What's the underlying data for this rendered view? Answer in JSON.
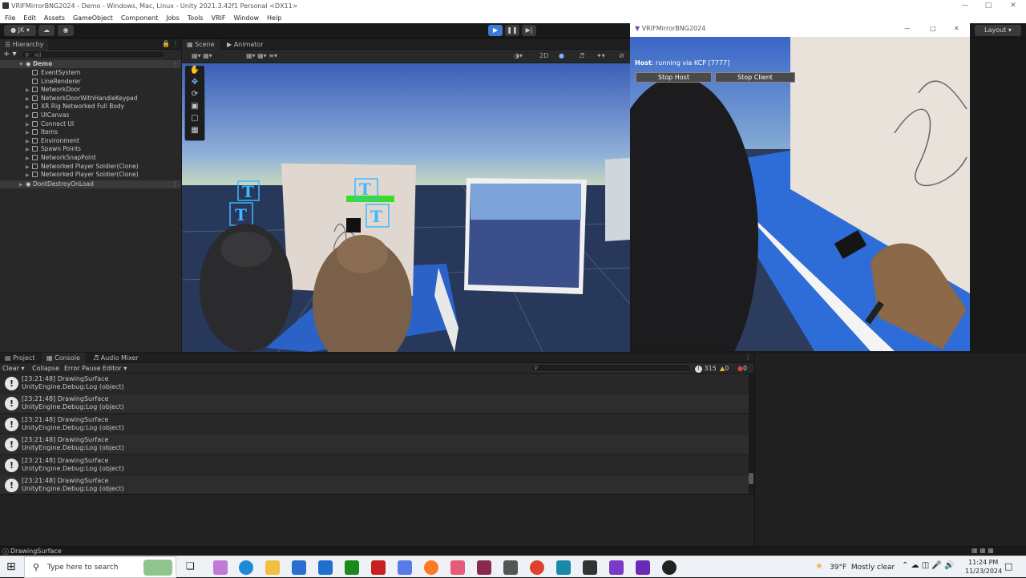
{
  "window": {
    "title": "VRIFMirrorBNG2024 - Demo - Windows, Mac, Linux - Unity 2021.3.42f1 Personal <DX11>"
  },
  "menu": [
    "File",
    "Edit",
    "Assets",
    "GameObject",
    "Component",
    "Jobs",
    "Tools",
    "VRIF",
    "Window",
    "Help"
  ],
  "toolbar": {
    "account": "JK",
    "layout": "Layout"
  },
  "hierarchy": {
    "tab": "Hierarchy",
    "search_placeholder": "All",
    "scene": "Demo",
    "items": [
      "EventSystem",
      "LineRenderer",
      "NetworkDoor",
      "NetworkDoorWithHandleKeypad",
      "XR Rig Networked Full Body",
      "UICanvas",
      "Connect UI",
      "Items",
      "Environment",
      "Spawn Points",
      "NetworkSnapPoint",
      "Networked Player Soldier(Clone)",
      "Networked Player Soldier(Clone)"
    ],
    "dont_destroy": "DontDestroyOnLoad"
  },
  "scene_view": {
    "tabs": [
      "Scene",
      "Animator"
    ],
    "mode_2d": "2D"
  },
  "game_window": {
    "title": "VRIFMirrorBNG2024",
    "host_label": "Host",
    "host_status": ": running via KCP [7777]",
    "stop_host": "Stop Host",
    "stop_client": "Stop Client"
  },
  "console": {
    "tabs": [
      "Project",
      "Console",
      "Audio Mixer"
    ],
    "buttons": [
      "Clear",
      "Collapse",
      "Error Pause",
      "Editor"
    ],
    "counts": {
      "log": "315",
      "warn": "0",
      "error": "0"
    },
    "logs": [
      {
        "line1": "[23:21:48] DrawingSurface",
        "line2": "UnityEngine.Debug:Log (object)"
      },
      {
        "line1": "[23:21:48] DrawingSurface",
        "line2": "UnityEngine.Debug:Log (object)"
      },
      {
        "line1": "[23:21:48] DrawingSurface",
        "line2": "UnityEngine.Debug:Log (object)"
      },
      {
        "line1": "[23:21:48] DrawingSurface",
        "line2": "UnityEngine.Debug:Log (object)"
      },
      {
        "line1": "[23:21:48] DrawingSurface",
        "line2": "UnityEngine.Debug:Log (object)"
      },
      {
        "line1": "[23:21:48] DrawingSurface",
        "line2": "UnityEngine.Debug:Log (object)"
      }
    ]
  },
  "statusbar": {
    "text": "DrawingSurface"
  },
  "taskbar": {
    "search_placeholder": "Type here to search",
    "weather": "39°F  Mostly clear",
    "time": "11:24 PM",
    "date": "11/23/2024"
  }
}
